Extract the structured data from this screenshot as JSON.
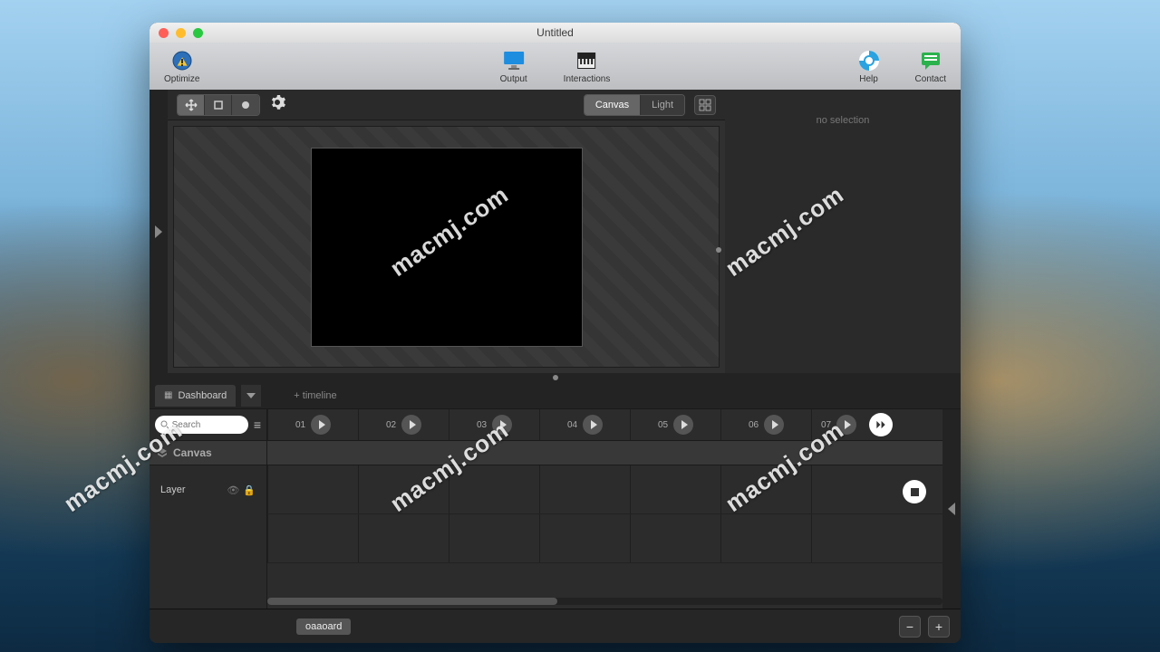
{
  "window": {
    "title": "Untitled"
  },
  "toolbar": {
    "optimize": "Optimize",
    "output": "Output",
    "interactions": "Interactions",
    "help": "Help",
    "contact": "Contact"
  },
  "canvasTabs": {
    "canvas": "Canvas",
    "light": "Light"
  },
  "inspector": {
    "noSelection": "no selection"
  },
  "dashboard": {
    "tabLabel": "Dashboard",
    "addTimeline": "+ timeline",
    "searchPlaceholder": "Search",
    "canvasHeader": "Canvas",
    "layerLabel": "Layer",
    "columns": [
      "01",
      "02",
      "03",
      "04",
      "05",
      "06",
      "07"
    ]
  },
  "footer": {
    "label": "oaaoard"
  },
  "watermark": "macmj.com"
}
